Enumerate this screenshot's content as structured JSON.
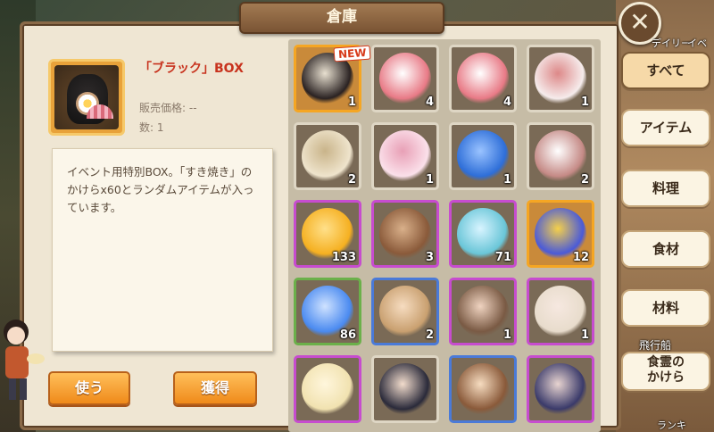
{
  "window": {
    "title": "倉庫"
  },
  "top_right": {
    "daily": "デイリー",
    "event": "イベ"
  },
  "detail": {
    "name": "「ブラック」BOX",
    "price": "販売価格: --",
    "quantity": "数: 1",
    "description": "イベント用特別BOX。「すき焼き」のかけらx60とランダムアイテムが入っています。",
    "icon": "black-box-icon"
  },
  "buttons": {
    "use": "使う",
    "obtain": "獲得"
  },
  "new_badge": "NEW",
  "items": [
    {
      "icon": "black-box-icon",
      "count": "1",
      "frame": "gold",
      "colors": [
        "#2a2222",
        "#e8e0d0"
      ]
    },
    {
      "icon": "red-eye-spirit-icon",
      "count": "4",
      "frame": "white",
      "colors": [
        "#e87a86",
        "#fff"
      ]
    },
    {
      "icon": "red-eye-spirit-icon",
      "count": "4",
      "frame": "white",
      "colors": [
        "#e87a86",
        "#fff"
      ]
    },
    {
      "icon": "white-spirit-icon",
      "count": "1",
      "frame": "white",
      "colors": [
        "#f6ecec",
        "#d88"
      ]
    },
    {
      "icon": "cream-spirit-icon",
      "count": "2",
      "frame": "white",
      "colors": [
        "#efe4cc",
        "#c9b48a"
      ]
    },
    {
      "icon": "pink-spirit-icon",
      "count": "1",
      "frame": "white",
      "colors": [
        "#fbe0ea",
        "#e8a0b6"
      ]
    },
    {
      "icon": "blue-ghost-icon",
      "count": "1",
      "frame": "white",
      "colors": [
        "#2e6ed8",
        "#9ac3ff"
      ]
    },
    {
      "icon": "brown-eye-spirit-icon",
      "count": "2",
      "frame": "white",
      "colors": [
        "#c58a86",
        "#fff"
      ]
    },
    {
      "icon": "golden-garlic-icon",
      "count": "133",
      "frame": "purple",
      "colors": [
        "#f5b021",
        "#ffe08a"
      ]
    },
    {
      "icon": "clay-pot-icon",
      "count": "3",
      "frame": "purple",
      "colors": [
        "#8a5a3a",
        "#d9b08a"
      ]
    },
    {
      "icon": "blue-scroll-icon",
      "count": "71",
      "frame": "purple",
      "colors": [
        "#6ac6d8",
        "#d8f4ff"
      ]
    },
    {
      "icon": "gift-box-icon",
      "count": "12",
      "frame": "gold",
      "colors": [
        "#4a5ad8",
        "#f5d04a"
      ]
    },
    {
      "icon": "blue-bottle-icon",
      "count": "86",
      "frame": "green",
      "colors": [
        "#4a8af0",
        "#cfe2ff"
      ]
    },
    {
      "icon": "character-shard-icon",
      "count": "2",
      "frame": "blue",
      "colors": [
        "#c9a070",
        "#f6dcc0"
      ]
    },
    {
      "icon": "character-shard-icon",
      "count": "1",
      "frame": "purple",
      "colors": [
        "#7a5a44",
        "#efd3c0"
      ]
    },
    {
      "icon": "character-shard-icon",
      "count": "1",
      "frame": "purple",
      "colors": [
        "#e8dccc",
        "#f6e8e0"
      ]
    },
    {
      "icon": "character-shard-icon",
      "count": "",
      "frame": "purple",
      "colors": [
        "#f1e2b0",
        "#fff6dc"
      ]
    },
    {
      "icon": "character-shard-icon",
      "count": "",
      "frame": "white",
      "colors": [
        "#2a2a3a",
        "#f2dccc"
      ]
    },
    {
      "icon": "character-shard-icon",
      "count": "",
      "frame": "blue",
      "colors": [
        "#8a5a3a",
        "#f6dcc0"
      ]
    },
    {
      "icon": "character-shard-icon",
      "count": "",
      "frame": "purple",
      "colors": [
        "#3a3a6a",
        "#e8d4d0"
      ]
    }
  ],
  "tabs": [
    {
      "label": "すべて",
      "active": true
    },
    {
      "label": "アイテム",
      "active": false
    },
    {
      "label": "料理",
      "active": false
    },
    {
      "label": "食材",
      "active": false
    },
    {
      "label": "材料",
      "active": false
    },
    {
      "label": "食霊の\nかけら",
      "active": false
    }
  ],
  "side_labels": {
    "airship": "飛行船",
    "ranking": "ランキ"
  }
}
